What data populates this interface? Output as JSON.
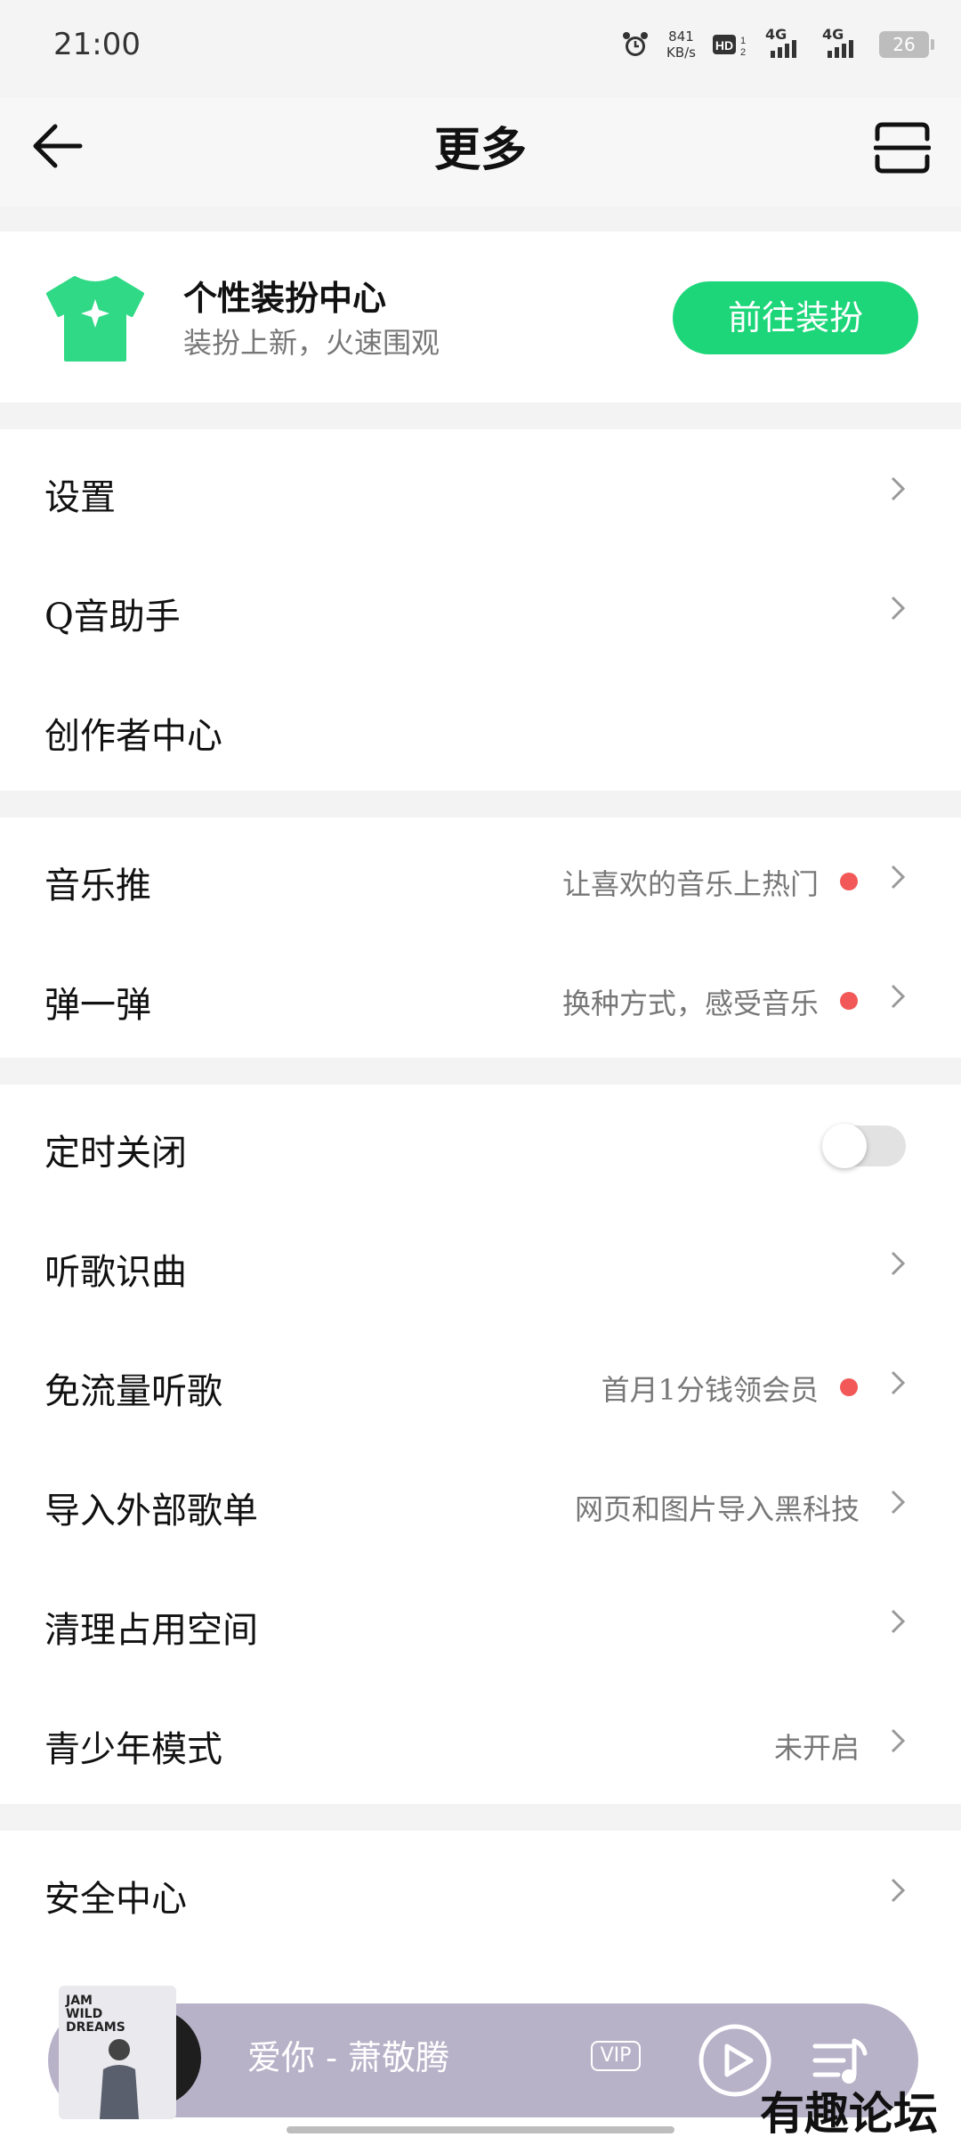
{
  "status_bar": {
    "time": "21:00",
    "speed_value": "841",
    "speed_unit": "KB/s",
    "network_1": "4G",
    "network_2": "4G",
    "battery": "26"
  },
  "nav": {
    "title": "更多",
    "back_icon": "back-arrow-icon",
    "scan_icon": "scan-icon"
  },
  "theme_card": {
    "title": "个性装扮中心",
    "subtitle": "装扮上新，火速围观",
    "button_label": "前往装扮",
    "accent": "#1ed67a"
  },
  "menu": {
    "group1": [
      {
        "label": "设置",
        "hint": ""
      },
      {
        "label": "Q音助手",
        "hint": ""
      },
      {
        "label": "创作者中心",
        "hint": ""
      }
    ],
    "group2": [
      {
        "label": "音乐推",
        "hint": "让喜欢的音乐上热门"
      },
      {
        "label": "弹一弹",
        "hint": "换种方式，感受音乐"
      }
    ],
    "group3": [
      {
        "label": "定时关闭",
        "hint": ""
      },
      {
        "label": "听歌识曲",
        "hint": ""
      },
      {
        "label": "免流量听歌",
        "hint": "首月1分钱领会员"
      },
      {
        "label": "导入外部歌单",
        "hint": "网页和图片导入黑科技"
      },
      {
        "label": "清理占用空间",
        "hint": ""
      },
      {
        "label": "青少年模式",
        "hint": "未开启"
      }
    ],
    "group4": [
      {
        "label": "安全中心",
        "hint": ""
      }
    ],
    "dot_color": "#f25858"
  },
  "player": {
    "song": "爱你 - 萧敬腾",
    "vip_label": "VIP",
    "cover_text": "JAM WILD DREAMS"
  },
  "watermark": "有趣论坛"
}
